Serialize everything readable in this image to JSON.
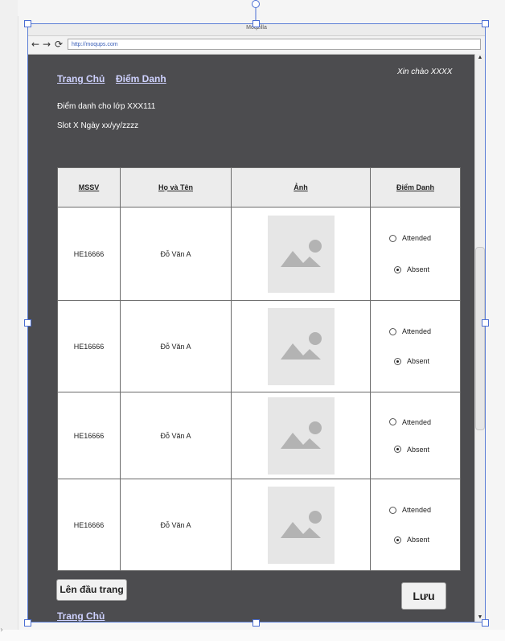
{
  "browser": {
    "title": "Moqzilla",
    "url": "http://moqups.com",
    "back_icon": "arrow-left-icon",
    "forward_icon": "arrow-right-icon",
    "reload_icon": "reload-icon"
  },
  "nav": {
    "home": "Trang Chủ",
    "attendance": "Điểm Danh"
  },
  "greeting": "Xin chào XXXX",
  "info": {
    "class_line": "Điểm danh cho lớp XXX111",
    "slot_line": "Slot X Ngày xx/yy/zzzz"
  },
  "table": {
    "headers": [
      "MSSV",
      "Họ và Tên",
      "Ảnh",
      "Điểm Danh"
    ],
    "rows": [
      {
        "id": "HE16666",
        "name": "Đỗ Văn A",
        "options": [
          "Attended",
          "Absent"
        ],
        "selected": "Absent"
      },
      {
        "id": "HE16666",
        "name": "Đỗ Văn A",
        "options": [
          "Attended",
          "Absent"
        ],
        "selected": "Absent"
      },
      {
        "id": "HE16666",
        "name": "Đỗ Văn A",
        "options": [
          "Attended",
          "Absent"
        ],
        "selected": "Absent"
      },
      {
        "id": "HE16666",
        "name": "Đỗ Văn A",
        "options": [
          "Attended",
          "Absent"
        ],
        "selected": "Absent"
      }
    ]
  },
  "buttons": {
    "top": "Lên đầu trang",
    "save": "Lưu"
  },
  "footer": {
    "home": "Trang Chủ"
  },
  "colors": {
    "canvas_bg": "#4c4c4f",
    "link": "#cfd2ff",
    "selection": "#4b6ed3"
  }
}
